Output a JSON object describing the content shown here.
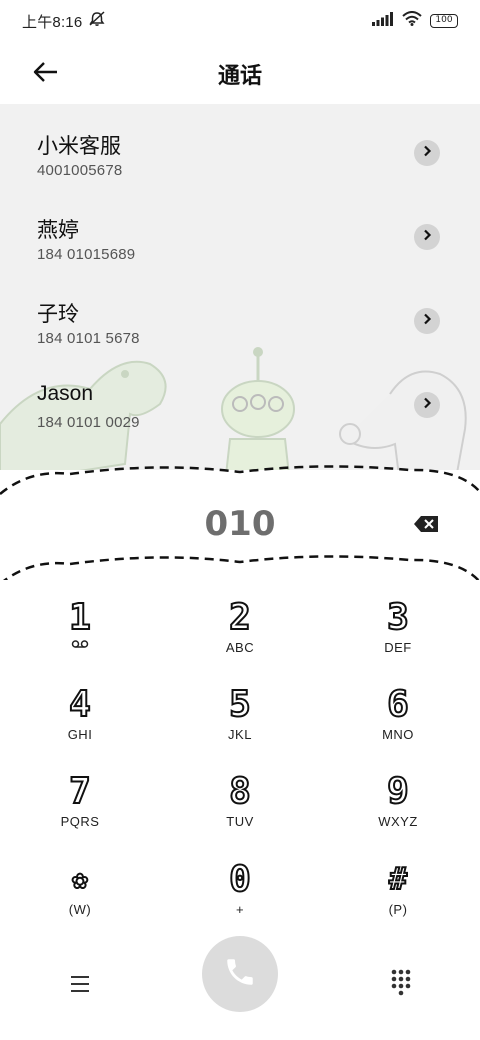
{
  "status_bar": {
    "time": "上午8:16",
    "battery": "100",
    "icons": [
      "mute-bell-icon",
      "signal-icon",
      "wifi-icon",
      "battery-icon"
    ]
  },
  "header": {
    "title": "通话",
    "back_icon": "arrow-left-icon"
  },
  "contacts": [
    {
      "name": "小米客服",
      "number": "4001005678"
    },
    {
      "name": "燕婷",
      "number": "184 01015689"
    },
    {
      "name": "子玲",
      "number": "184 0101 5678"
    },
    {
      "name": "Jason",
      "number": "184 0101 0029"
    }
  ],
  "dialer": {
    "number": "010",
    "backspace_icon": "backspace-icon"
  },
  "keypad": {
    "keys": [
      {
        "digit": "1",
        "sub": ""
      },
      {
        "digit": "2",
        "sub": "ABC"
      },
      {
        "digit": "3",
        "sub": "DEF"
      },
      {
        "digit": "4",
        "sub": "GHI"
      },
      {
        "digit": "5",
        "sub": "JKL"
      },
      {
        "digit": "6",
        "sub": "MNO"
      },
      {
        "digit": "7",
        "sub": "PQRS"
      },
      {
        "digit": "8",
        "sub": "TUV"
      },
      {
        "digit": "9",
        "sub": "WXYZ"
      },
      {
        "digit": "✿",
        "sub": "(W)"
      },
      {
        "digit": "0",
        "sub": "+"
      },
      {
        "digit": "#",
        "sub": "(P)"
      }
    ]
  },
  "bottom_bar": {
    "menu_icon": "menu-icon",
    "call_icon": "phone-icon",
    "keypad_icon": "dialpad-icon"
  },
  "theme": {
    "list_background": "#f1f1f1",
    "call_button": "#dcdcdc",
    "accent": "#111111"
  }
}
